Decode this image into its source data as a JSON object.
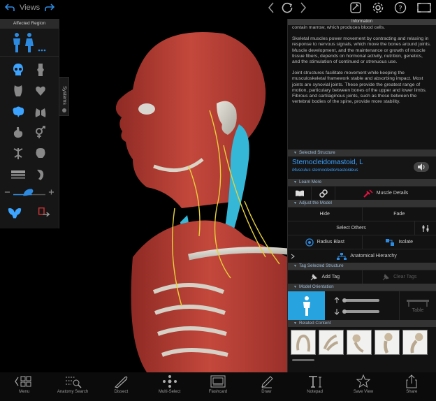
{
  "topbar": {
    "views_label": "Views"
  },
  "left_panel": {
    "header": "Affected Region",
    "systems_tab": "Systems"
  },
  "info_panel": {
    "header": "Information",
    "paragraphs": [
      "contain marrow, which produces blood cells.",
      "Skeletal muscles power movement by contracting and relaxing in response to nervous signals, which move the bones around joints. Muscle development, and the maintenance or growth of muscle tissue fibers, depends on hormonal activity, nutrition, genetics, and the stimulation of continued or strenuous use.",
      "Joint structures facilitate movement while keeping the musculoskeletal framework stable and absorbing impact. Most joints are synovial joints. These provide the greatest range of motion, particulary between bones of the upper and lower limbs. Fibrous and cartilaginous joints, such as those between the vertebral bodies of the spine, provide more stability."
    ],
    "selected_structure": {
      "section": "Selected Structure",
      "name": "Sternocleidomastoid, L",
      "latin": "Musculus sternocleidomastoideus"
    },
    "learn_more": {
      "section": "Learn More",
      "muscle_details": "Muscle Details"
    },
    "adjust": {
      "section": "Adjust the Model",
      "hide": "Hide",
      "fade": "Fade",
      "select_others": "Select Others",
      "radius_blast": "Radius Blast",
      "isolate": "Isolate",
      "hierarchy": "Anatomical Hierarchy"
    },
    "tag": {
      "section": "Tag Selected Structure",
      "add_tag": "Add Tag",
      "clear_tags": "Clear Tags"
    },
    "orientation": {
      "section": "Model Orientation",
      "table": "Table"
    },
    "related": {
      "section": "Related Content"
    }
  },
  "toolbar": {
    "items": [
      "Menu",
      "Anatomy Search",
      "Dissect",
      "Multi-Select",
      "Flashcard",
      "Draw",
      "Notepad",
      "Save View",
      "Share"
    ]
  },
  "colors": {
    "accent": "#2c8be0",
    "selected": "#27a3e0",
    "muscle": "#b53a32",
    "highlight": "#35b7d8"
  }
}
